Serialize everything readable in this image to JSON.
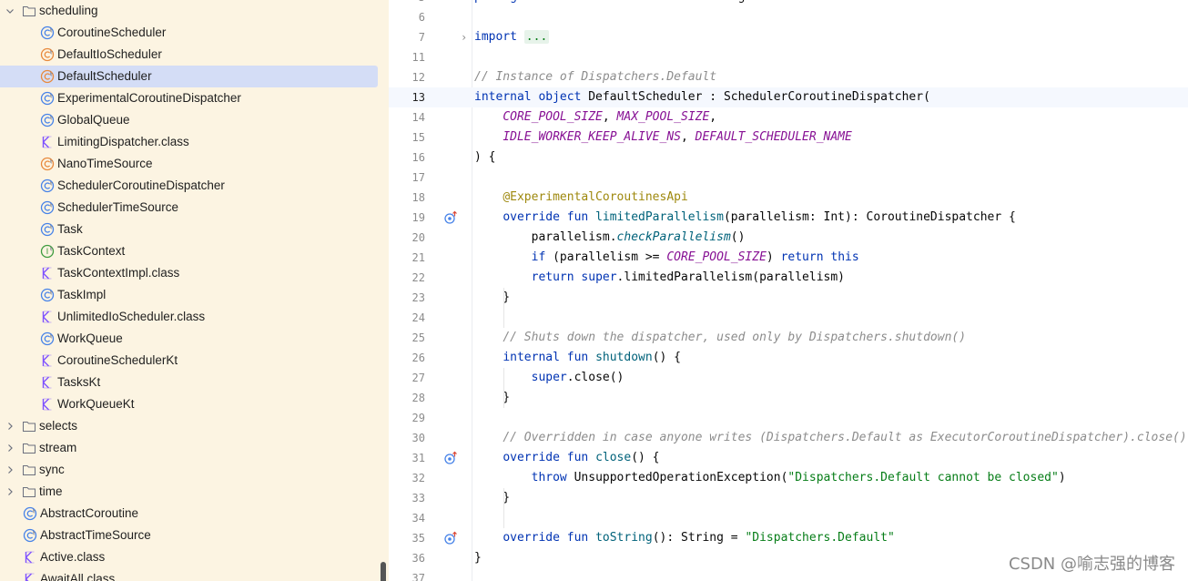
{
  "project_tree": {
    "items": [
      {
        "label": "scheduling",
        "kind": "folder",
        "expanded": true,
        "depth": 0
      },
      {
        "label": "CoroutineScheduler",
        "kind": "class",
        "depth": 1
      },
      {
        "label": "DefaultIoScheduler",
        "kind": "object",
        "depth": 1
      },
      {
        "label": "DefaultScheduler",
        "kind": "object",
        "depth": 1,
        "selected": true
      },
      {
        "label": "ExperimentalCoroutineDispatcher",
        "kind": "class",
        "depth": 1
      },
      {
        "label": "GlobalQueue",
        "kind": "class",
        "depth": 1
      },
      {
        "label": "LimitingDispatcher.class",
        "kind": "classfile",
        "depth": 1
      },
      {
        "label": "NanoTimeSource",
        "kind": "object",
        "depth": 1
      },
      {
        "label": "SchedulerCoroutineDispatcher",
        "kind": "class",
        "depth": 1
      },
      {
        "label": "SchedulerTimeSource",
        "kind": "class",
        "depth": 1
      },
      {
        "label": "Task",
        "kind": "class",
        "depth": 1
      },
      {
        "label": "TaskContext",
        "kind": "interface",
        "depth": 1
      },
      {
        "label": "TaskContextImpl.class",
        "kind": "classfile",
        "depth": 1
      },
      {
        "label": "TaskImpl",
        "kind": "class",
        "depth": 1
      },
      {
        "label": "UnlimitedIoScheduler.class",
        "kind": "classfile",
        "depth": 1
      },
      {
        "label": "WorkQueue",
        "kind": "class",
        "depth": 1
      },
      {
        "label": "CoroutineSchedulerKt",
        "kind": "classfile",
        "depth": 1
      },
      {
        "label": "TasksKt",
        "kind": "classfile",
        "depth": 1
      },
      {
        "label": "WorkQueueKt",
        "kind": "classfile",
        "depth": 1
      },
      {
        "label": "selects",
        "kind": "folder",
        "expanded": false,
        "depth": 0
      },
      {
        "label": "stream",
        "kind": "folder",
        "expanded": false,
        "depth": 0
      },
      {
        "label": "sync",
        "kind": "folder",
        "expanded": false,
        "depth": 0
      },
      {
        "label": "time",
        "kind": "folder",
        "expanded": false,
        "depth": 0
      },
      {
        "label": "AbstractCoroutine",
        "kind": "class",
        "depth": -1
      },
      {
        "label": "AbstractTimeSource",
        "kind": "class",
        "depth": -1
      },
      {
        "label": "Active.class",
        "kind": "classfile",
        "depth": -1
      },
      {
        "label": "AwaitAll.class",
        "kind": "classfile",
        "depth": -1
      }
    ]
  },
  "editor": {
    "top_fragment": "package kotlinx.coroutines.scheduling",
    "lines": [
      {
        "n": "5",
        "segs": [
          [
            "kw",
            "package"
          ],
          [
            "",
            "  kotlinx.coroutines.scheduling"
          ]
        ]
      },
      {
        "n": "6",
        "segs": []
      },
      {
        "n": "7",
        "fold": true,
        "segs": [
          [
            "kw",
            "import"
          ],
          [
            "",
            " "
          ],
          [
            "fold-ph",
            "..."
          ]
        ]
      },
      {
        "n": "11",
        "segs": []
      },
      {
        "n": "12",
        "segs": [
          [
            "cm",
            "// Instance of Dispatchers.Default"
          ]
        ]
      },
      {
        "n": "13",
        "caret": true,
        "segs": [
          [
            "kw",
            "internal object "
          ],
          [
            "",
            "DefaultScheduler : SchedulerCoroutineDispatcher("
          ]
        ]
      },
      {
        "n": "14",
        "segs": [
          [
            "",
            "    "
          ],
          [
            "cn",
            "CORE_POOL_SIZE"
          ],
          [
            "",
            ", "
          ],
          [
            "cn",
            "MAX_POOL_SIZE"
          ],
          [
            "",
            ","
          ]
        ]
      },
      {
        "n": "15",
        "segs": [
          [
            "",
            "    "
          ],
          [
            "cn",
            "IDLE_WORKER_KEEP_ALIVE_NS"
          ],
          [
            "",
            ", "
          ],
          [
            "cn",
            "DEFAULT_SCHEDULER_NAME"
          ]
        ]
      },
      {
        "n": "16",
        "segs": [
          [
            "",
            ") {"
          ]
        ]
      },
      {
        "n": "17",
        "segs": []
      },
      {
        "n": "18",
        "segs": [
          [
            "",
            "    "
          ],
          [
            "an",
            "@ExperimentalCoroutinesApi"
          ]
        ]
      },
      {
        "n": "19",
        "override": true,
        "segs": [
          [
            "",
            "    "
          ],
          [
            "kw",
            "override fun "
          ],
          [
            "fn",
            "limitedParallelism"
          ],
          [
            "",
            "(parallelism: Int): CoroutineDispatcher {"
          ]
        ]
      },
      {
        "n": "20",
        "segs": [
          [
            "",
            "        parallelism."
          ],
          [
            "ext",
            "checkParallelism"
          ],
          [
            "",
            "()"
          ]
        ]
      },
      {
        "n": "21",
        "segs": [
          [
            "",
            "        "
          ],
          [
            "kw",
            "if "
          ],
          [
            "",
            "(parallelism >= "
          ],
          [
            "cn",
            "CORE_POOL_SIZE"
          ],
          [
            "",
            ") "
          ],
          [
            "kw",
            "return this"
          ]
        ]
      },
      {
        "n": "22",
        "segs": [
          [
            "",
            "        "
          ],
          [
            "kw",
            "return super"
          ],
          [
            "",
            ".limitedParallelism(parallelism)"
          ]
        ]
      },
      {
        "n": "23",
        "segs": [
          [
            "",
            "    }"
          ]
        ]
      },
      {
        "n": "24",
        "segs": []
      },
      {
        "n": "25",
        "segs": [
          [
            "",
            "    "
          ],
          [
            "cm",
            "// Shuts down the dispatcher, used only by Dispatchers.shutdown()"
          ]
        ]
      },
      {
        "n": "26",
        "segs": [
          [
            "",
            "    "
          ],
          [
            "kw",
            "internal fun "
          ],
          [
            "fn",
            "shutdown"
          ],
          [
            "",
            "() {"
          ]
        ]
      },
      {
        "n": "27",
        "segs": [
          [
            "",
            "        "
          ],
          [
            "kw",
            "super"
          ],
          [
            "",
            ".close()"
          ]
        ]
      },
      {
        "n": "28",
        "segs": [
          [
            "",
            "    }"
          ]
        ]
      },
      {
        "n": "29",
        "segs": []
      },
      {
        "n": "30",
        "segs": [
          [
            "",
            "    "
          ],
          [
            "cm",
            "// Overridden in case anyone writes (Dispatchers.Default as ExecutorCoroutineDispatcher).close()"
          ]
        ]
      },
      {
        "n": "31",
        "override": true,
        "segs": [
          [
            "",
            "    "
          ],
          [
            "kw",
            "override fun "
          ],
          [
            "fn",
            "close"
          ],
          [
            "",
            "() {"
          ]
        ]
      },
      {
        "n": "32",
        "segs": [
          [
            "",
            "        "
          ],
          [
            "kw",
            "throw "
          ],
          [
            "",
            "UnsupportedOperationException("
          ],
          [
            "st",
            "\"Dispatchers.Default cannot be closed\""
          ],
          [
            "",
            ")"
          ]
        ]
      },
      {
        "n": "33",
        "segs": [
          [
            "",
            "    }"
          ]
        ]
      },
      {
        "n": "34",
        "segs": []
      },
      {
        "n": "35",
        "override": true,
        "segs": [
          [
            "",
            "    "
          ],
          [
            "kw",
            "override fun "
          ],
          [
            "fn",
            "toString"
          ],
          [
            "",
            "(): String = "
          ],
          [
            "st",
            "\"Dispatchers.Default\""
          ]
        ]
      },
      {
        "n": "36",
        "segs": [
          [
            "",
            "}"
          ]
        ]
      },
      {
        "n": "37",
        "segs": []
      }
    ]
  },
  "watermark": "CSDN @喻志强的博客",
  "colors": {
    "tree_bg": "#fcf4e2",
    "selection": "#d4ddf6",
    "keyword": "#0033b3",
    "comment": "#8c8c8c",
    "constant": "#871094",
    "string": "#067d17",
    "annotation": "#9e880d",
    "function": "#00627a"
  }
}
